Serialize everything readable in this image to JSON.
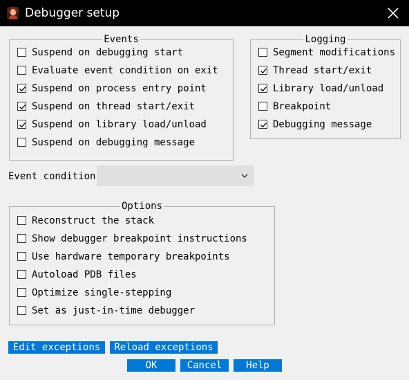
{
  "window": {
    "title": "Debugger setup"
  },
  "events": {
    "legend": "Events",
    "items": [
      {
        "label": "Suspend on debugging start",
        "checked": false
      },
      {
        "label": "Evaluate event condition on exit",
        "checked": false
      },
      {
        "label": "Suspend on process entry point",
        "checked": true
      },
      {
        "label": "Suspend on thread start/exit",
        "checked": true
      },
      {
        "label": "Suspend on library load/unload",
        "checked": true
      },
      {
        "label": "Suspend on debugging message",
        "checked": false
      }
    ]
  },
  "logging": {
    "legend": "Logging",
    "items": [
      {
        "label": "Segment modifications",
        "checked": false
      },
      {
        "label": "Thread start/exit",
        "checked": true
      },
      {
        "label": "Library load/unload",
        "checked": true
      },
      {
        "label": "Breakpoint",
        "checked": false
      },
      {
        "label": "Debugging message",
        "checked": true
      }
    ]
  },
  "event_condition": {
    "label": "Event condition",
    "value": ""
  },
  "options": {
    "legend": "Options",
    "items": [
      {
        "label": "Reconstruct the stack",
        "checked": false
      },
      {
        "label": "Show debugger breakpoint instructions",
        "checked": false
      },
      {
        "label": "Use hardware temporary breakpoints",
        "checked": false
      },
      {
        "label": "Autoload PDB files",
        "checked": false
      },
      {
        "label": "Optimize single-stepping",
        "checked": false
      },
      {
        "label": "Set as just-in-time debugger",
        "checked": false
      }
    ]
  },
  "buttons": {
    "edit_exceptions": "Edit exceptions",
    "reload_exceptions": "Reload exceptions",
    "ok": "OK",
    "cancel": "Cancel",
    "help": "Help"
  },
  "colors": {
    "accent": "#0078d7",
    "titlebar": "#000000",
    "background": "#f0f0f0"
  }
}
